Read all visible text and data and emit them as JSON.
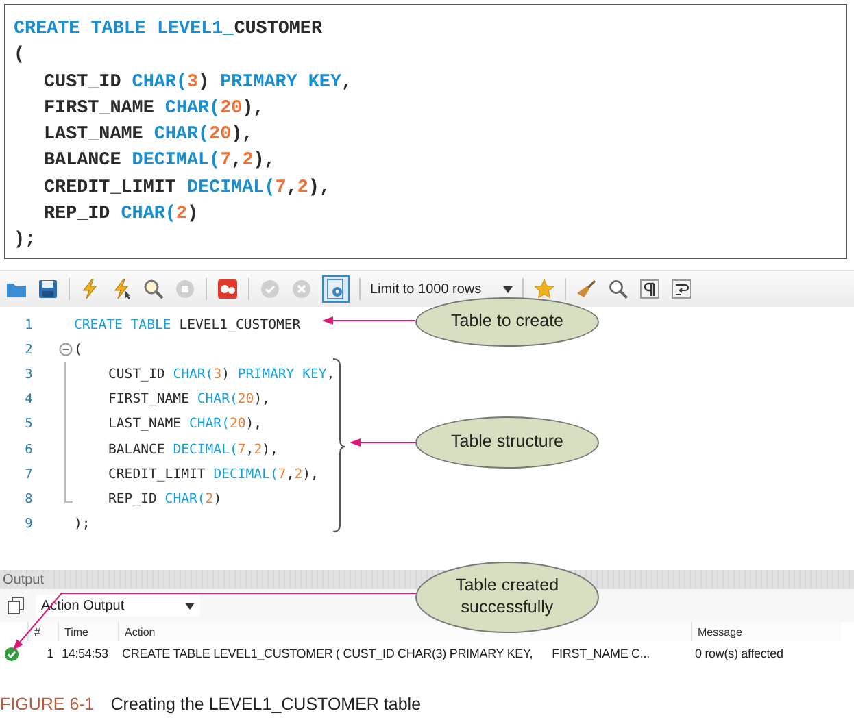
{
  "listing": {
    "lines": [
      {
        "tokens": [
          {
            "text": "CREATE TABLE LEVEL1_",
            "kind": "keyword"
          },
          {
            "text": "CUSTOMER",
            "kind": "plain"
          }
        ]
      },
      {
        "tokens": [
          {
            "text": "(",
            "kind": "plain"
          }
        ],
        "children": [
          {
            "tokens": [
              {
                "text": "CUST_ID ",
                "kind": "plain"
              },
              {
                "text": "CHAR(",
                "kind": "keyword"
              },
              {
                "text": "3",
                "kind": "number"
              },
              {
                "text": ") ",
                "kind": "plain"
              },
              {
                "text": "PRIMARY KEY",
                "kind": "keyword"
              },
              {
                "text": ",",
                "kind": "plain"
              }
            ]
          },
          {
            "tokens": [
              {
                "text": "FIRST_NAME ",
                "kind": "plain"
              },
              {
                "text": "CHAR(",
                "kind": "keyword"
              },
              {
                "text": "20",
                "kind": "number"
              },
              {
                "text": "),",
                "kind": "plain"
              }
            ]
          },
          {
            "tokens": [
              {
                "text": "LAST_NAME ",
                "kind": "plain"
              },
              {
                "text": "CHAR(",
                "kind": "keyword"
              },
              {
                "text": "20",
                "kind": "number"
              },
              {
                "text": "),",
                "kind": "plain"
              }
            ]
          },
          {
            "tokens": [
              {
                "text": "BALANCE ",
                "kind": "plain"
              },
              {
                "text": "DECIMAL(",
                "kind": "keyword"
              },
              {
                "text": "7,2",
                "kind": "number"
              },
              {
                "text": "),",
                "kind": "plain"
              }
            ]
          },
          {
            "tokens": [
              {
                "text": "CREDIT_LIMIT ",
                "kind": "plain"
              },
              {
                "text": "DECIMAL(",
                "kind": "keyword"
              },
              {
                "text": "7,2",
                "kind": "number"
              },
              {
                "text": "),",
                "kind": "plain"
              }
            ]
          },
          {
            "tokens": [
              {
                "text": "REP_ID ",
                "kind": "plain"
              },
              {
                "text": "CHAR(",
                "kind": "keyword"
              },
              {
                "text": "2",
                "kind": "number"
              },
              {
                "text": ")",
                "kind": "plain"
              }
            ]
          }
        ]
      },
      {
        "tokens": [
          {
            "text": ");",
            "kind": "plain"
          }
        ]
      }
    ]
  },
  "toolbar": {
    "toggle_selected": true,
    "limit": "Limit to 1000 rows"
  },
  "editor": {
    "lines": [
      {
        "number": "1",
        "tokens": [
          {
            "text": "CREATE TABLE ",
            "kind": "keyword"
          },
          {
            "text": "LEVEL1_CUSTOMER",
            "kind": "plain"
          }
        ]
      },
      {
        "number": "2",
        "tokens": [
          {
            "text": "(",
            "kind": "plain"
          }
        ],
        "children": [
          {
            "number": "3",
            "tokens": [
              {
                "text": "CUST_ID ",
                "kind": "plain"
              },
              {
                "text": "CHAR(",
                "kind": "keyword"
              },
              {
                "text": "3",
                "kind": "number"
              },
              {
                "text": ") ",
                "kind": "plain"
              },
              {
                "text": "PRIMARY KEY",
                "kind": "keyword"
              },
              {
                "text": ",",
                "kind": "plain"
              }
            ]
          },
          {
            "number": "4",
            "tokens": [
              {
                "text": "FIRST_NAME ",
                "kind": "plain"
              },
              {
                "text": "CHAR(",
                "kind": "keyword"
              },
              {
                "text": "20",
                "kind": "number"
              },
              {
                "text": "),",
                "kind": "plain"
              }
            ]
          },
          {
            "number": "5",
            "tokens": [
              {
                "text": "LAST_NAME ",
                "kind": "plain"
              },
              {
                "text": "CHAR(",
                "kind": "keyword"
              },
              {
                "text": "20",
                "kind": "number"
              },
              {
                "text": "),",
                "kind": "plain"
              }
            ]
          },
          {
            "number": "6",
            "tokens": [
              {
                "text": "BALANCE ",
                "kind": "plain"
              },
              {
                "text": "DECIMAL(",
                "kind": "keyword"
              },
              {
                "text": "7,2",
                "kind": "number"
              },
              {
                "text": "),",
                "kind": "plain"
              }
            ]
          },
          {
            "number": "7",
            "tokens": [
              {
                "text": "CREDIT_LIMIT ",
                "kind": "plain"
              },
              {
                "text": "DECIMAL(",
                "kind": "keyword"
              },
              {
                "text": "7,2",
                "kind": "number"
              },
              {
                "text": "),",
                "kind": "plain"
              }
            ]
          },
          {
            "number": "8",
            "tokens": [
              {
                "text": "REP_ID ",
                "kind": "plain"
              },
              {
                "text": "CHAR(",
                "kind": "keyword"
              },
              {
                "text": "2",
                "kind": "number"
              },
              {
                "text": ")",
                "kind": "plain"
              }
            ]
          }
        ]
      },
      {
        "number": "9",
        "tokens": [
          {
            "text": ");",
            "kind": "plain"
          }
        ]
      }
    ]
  },
  "output": {
    "title": "Output",
    "dropdown": "Action Output",
    "columns": [
      "#",
      "Time",
      "Action",
      "Message"
    ],
    "rows": [
      {
        "success": true,
        "number": "1",
        "time": "14:54:53",
        "action": "CREATE TABLE LEVEL1_CUSTOMER ( CUST_ID CHAR(3) PRIMARY KEY,      FIRST_NAME C...",
        "message": "0 row(s) affected"
      }
    ]
  },
  "callouts": [
    "Table to create",
    "Table structure",
    "Table created successfully"
  ],
  "caption": {
    "label": "FIGURE 6-1",
    "text": "Creating the LEVEL1_CUSTOMER table"
  }
}
